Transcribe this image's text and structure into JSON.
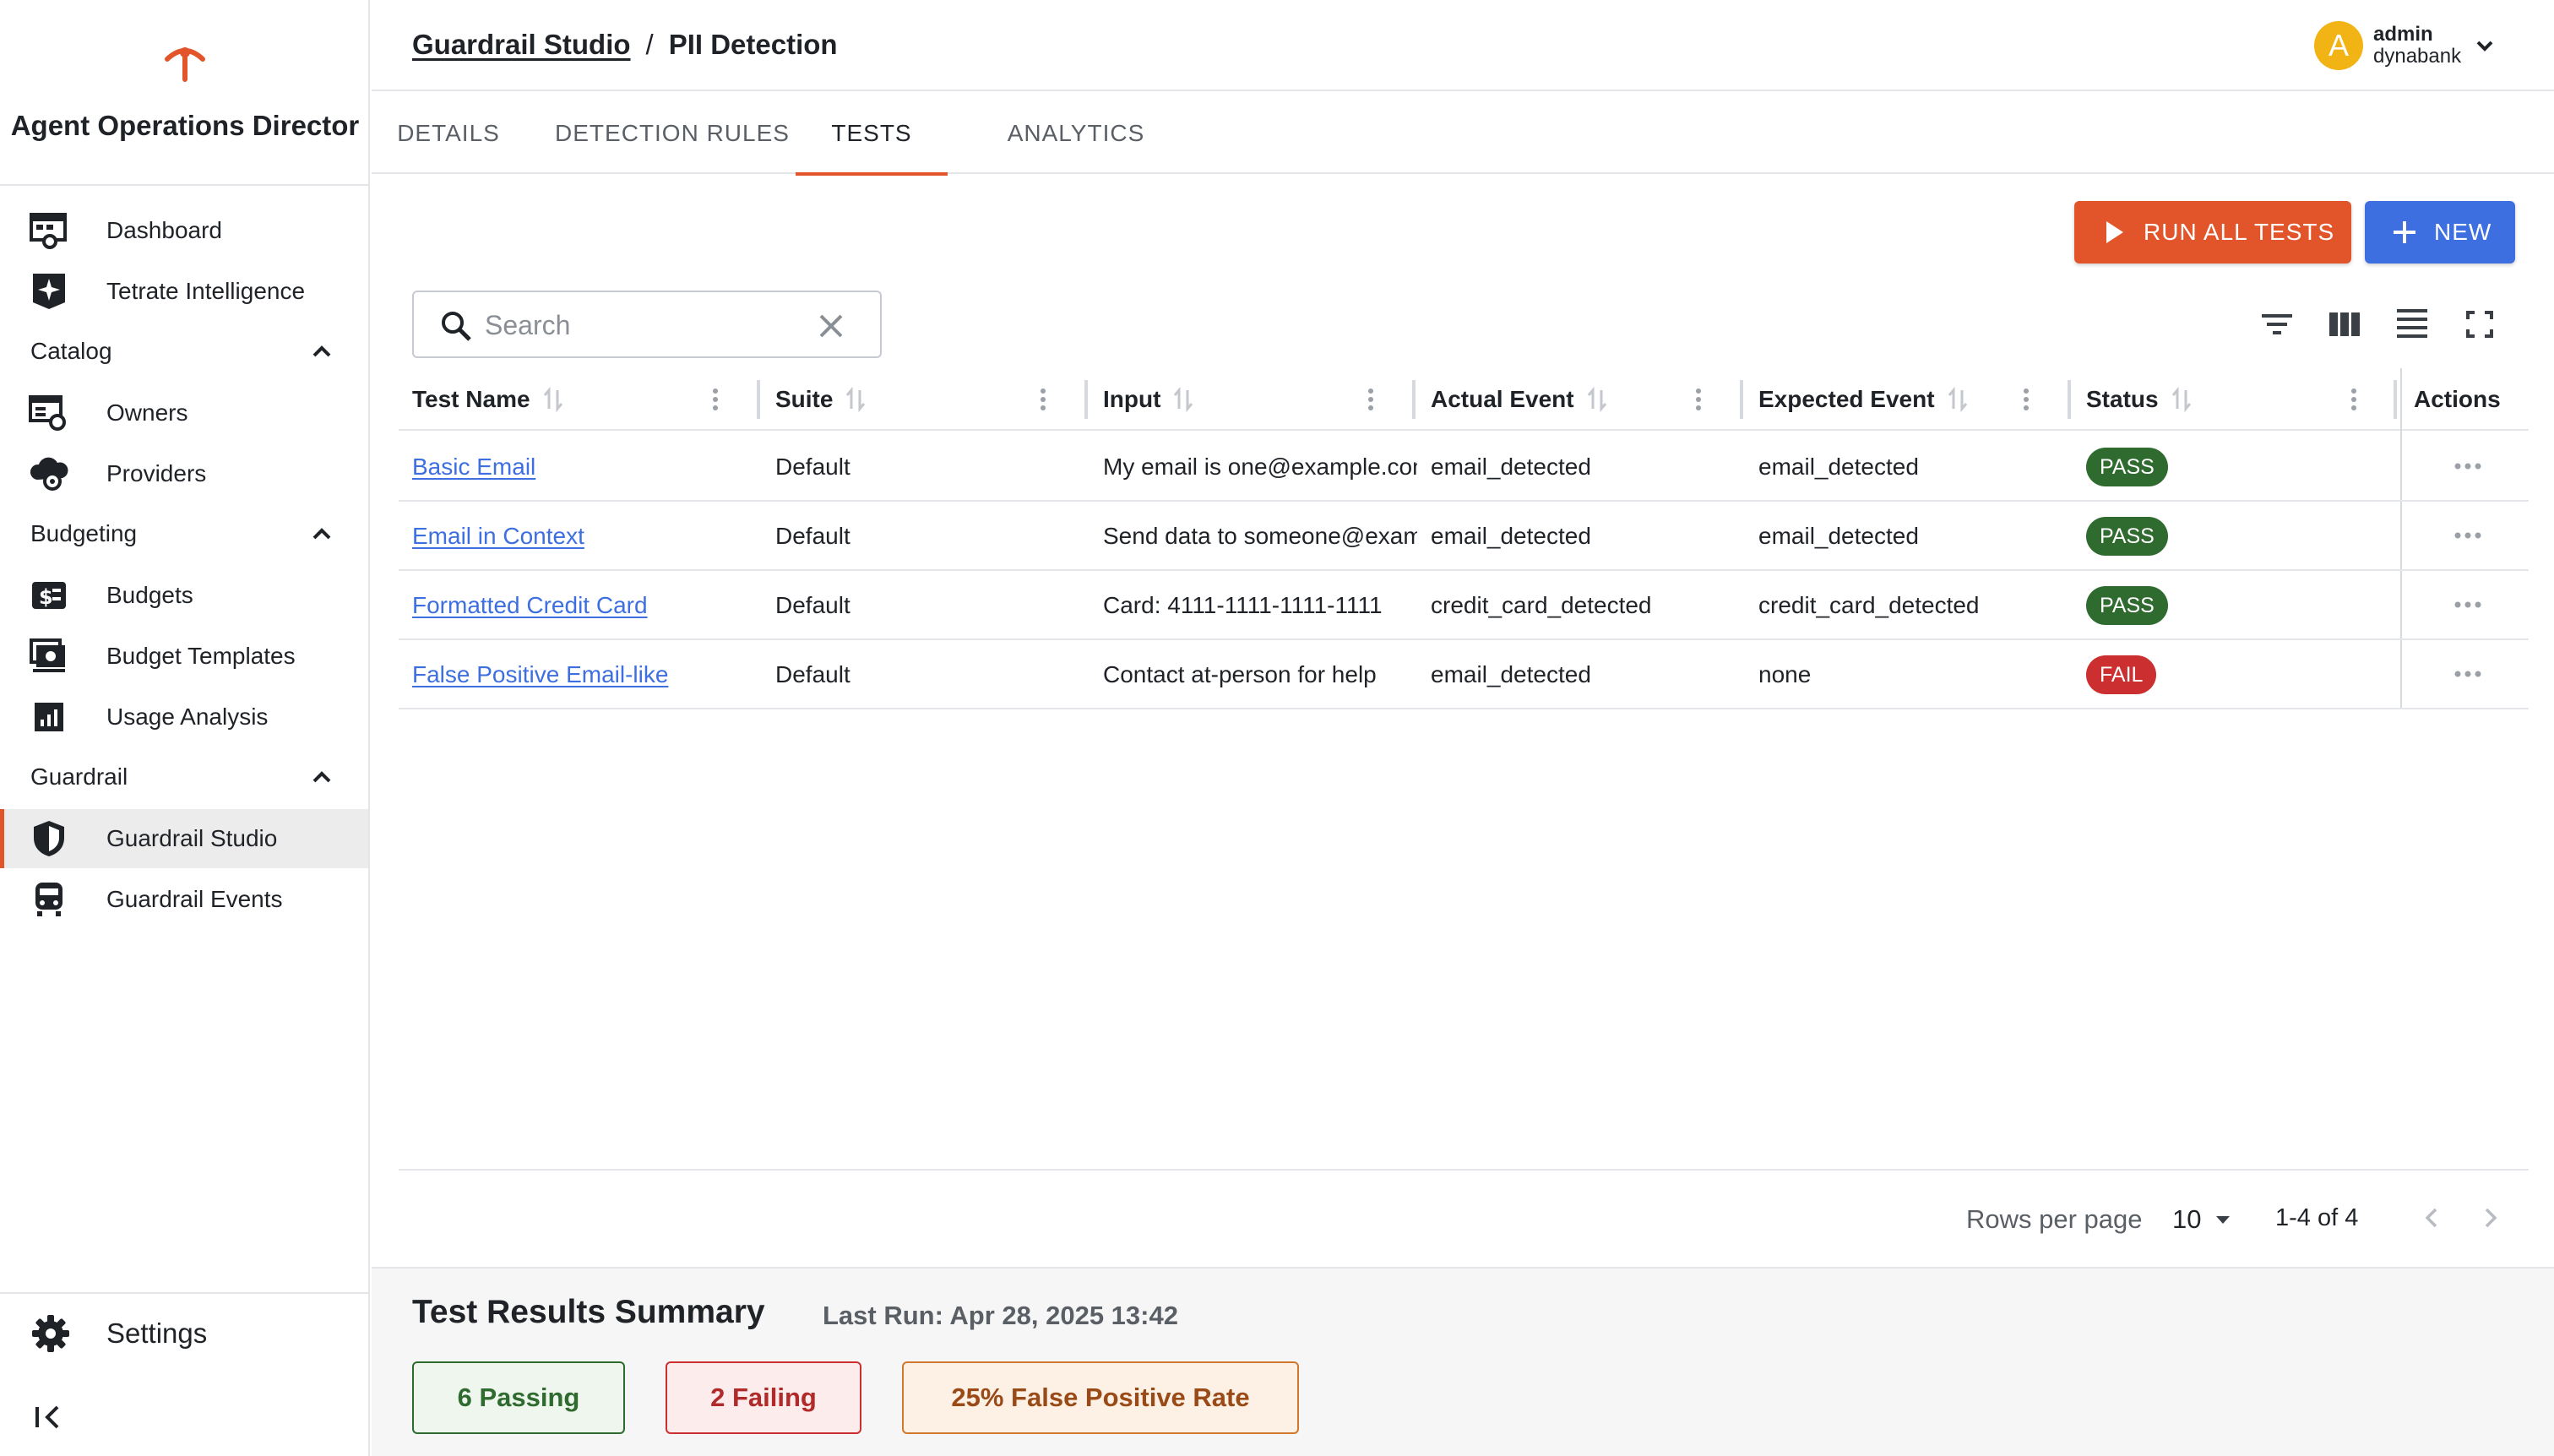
{
  "app": {
    "title": "Agent Operations Director",
    "accent_color": "#e2552b"
  },
  "sidebar": {
    "items": [
      {
        "label": "Dashboard",
        "icon": "dashboard-icon"
      },
      {
        "label": "Tetrate Intelligence",
        "icon": "sparkle-icon"
      }
    ],
    "sections": [
      {
        "label": "Catalog",
        "expanded": true,
        "items": [
          {
            "label": "Owners",
            "icon": "owners-icon"
          },
          {
            "label": "Providers",
            "icon": "cloud-gear-icon"
          }
        ]
      },
      {
        "label": "Budgeting",
        "expanded": true,
        "items": [
          {
            "label": "Budgets",
            "icon": "dollar-icon"
          },
          {
            "label": "Budget Templates",
            "icon": "template-icon"
          },
          {
            "label": "Usage Analysis",
            "icon": "bar-chart-icon"
          }
        ]
      },
      {
        "label": "Guardrail",
        "expanded": true,
        "items": [
          {
            "label": "Guardrail Studio",
            "icon": "shield-icon",
            "active": true
          },
          {
            "label": "Guardrail Events",
            "icon": "events-icon"
          }
        ]
      }
    ],
    "settings_label": "Settings"
  },
  "header": {
    "breadcrumb": {
      "parent": "Guardrail Studio",
      "separator": "/",
      "current": "PII Detection"
    },
    "user": {
      "initial": "A",
      "name": "admin",
      "org": "dynabank",
      "avatar_color": "#f2b415"
    }
  },
  "tabs": [
    {
      "label": "DETAILS",
      "active": false
    },
    {
      "label": "DETECTION RULES",
      "active": false
    },
    {
      "label": "TESTS",
      "active": true
    },
    {
      "label": "ANALYTICS",
      "active": false
    }
  ],
  "toolbar": {
    "run_all_label": "RUN ALL TESTS",
    "new_label": "NEW",
    "search_placeholder": "Search"
  },
  "table": {
    "columns": [
      "Test Name",
      "Suite",
      "Input",
      "Actual Event",
      "Expected Event",
      "Status",
      "Actions"
    ],
    "rows": [
      {
        "name": "Basic Email",
        "suite": "Default",
        "input": "My email is one@example.com",
        "actual": "email_detected",
        "expected": "email_detected",
        "status": "PASS"
      },
      {
        "name": "Email in Context",
        "suite": "Default",
        "input": "Send data to someone@example.com",
        "actual": "email_detected",
        "expected": "email_detected",
        "status": "PASS"
      },
      {
        "name": "Formatted Credit Card",
        "suite": "Default",
        "input": "Card: 4111-1111-1111-1111",
        "actual": "credit_card_detected",
        "expected": "credit_card_detected",
        "status": "PASS"
      },
      {
        "name": "False Positive Email-like",
        "suite": "Default",
        "input": "Contact at-person for help",
        "actual": "email_detected",
        "expected": "none",
        "status": "FAIL"
      }
    ]
  },
  "pagination": {
    "rows_per_page_label": "Rows per page",
    "rows_per_page": "10",
    "range": "1-4 of 4"
  },
  "summary": {
    "title": "Test Results Summary",
    "last_run": "Last Run: Apr 28, 2025 13:42",
    "passing": "6 Passing",
    "failing": "2 Failing",
    "false_positive_rate": "25% False Positive Rate"
  },
  "colors": {
    "pass": "#2f6b2f",
    "fail": "#cc2f2f",
    "primary_blue": "#3d6fe0",
    "warning": "#d0792e"
  }
}
